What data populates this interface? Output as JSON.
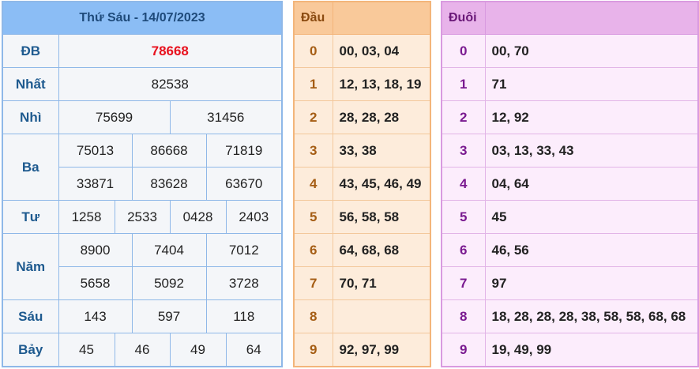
{
  "results": {
    "title": "Thứ Sáu - 14/07/2023",
    "db_label": "ĐB",
    "db": "78668",
    "nhat_label": "Nhất",
    "nhat": "82538",
    "nhi_label": "Nhì",
    "nhi": [
      "75699",
      "31456"
    ],
    "ba_label": "Ba",
    "ba": [
      "75013",
      "86668",
      "71819",
      "33871",
      "83628",
      "63670"
    ],
    "tu_label": "Tư",
    "tu": [
      "1258",
      "2533",
      "0428",
      "2403"
    ],
    "nam_label": "Năm",
    "nam": [
      "8900",
      "7404",
      "7012",
      "5658",
      "5092",
      "3728"
    ],
    "sau_label": "Sáu",
    "sau": [
      "143",
      "597",
      "118"
    ],
    "bay_label": "Bảy",
    "bay": [
      "45",
      "46",
      "49",
      "64"
    ]
  },
  "dau": {
    "title": "Đầu",
    "rows": [
      {
        "k": "0",
        "v": "00, 03, 04"
      },
      {
        "k": "1",
        "v": "12, 13, 18, 19"
      },
      {
        "k": "2",
        "v": "28, 28, 28"
      },
      {
        "k": "3",
        "v": "33, 38"
      },
      {
        "k": "4",
        "v": "43, 45, 46, 49"
      },
      {
        "k": "5",
        "v": "56, 58, 58"
      },
      {
        "k": "6",
        "v": "64, 68, 68"
      },
      {
        "k": "7",
        "v": "70, 71"
      },
      {
        "k": "8",
        "v": ""
      },
      {
        "k": "9",
        "v": "92, 97, 99"
      }
    ]
  },
  "duoi": {
    "title": "Đuôi",
    "rows": [
      {
        "k": "0",
        "v": "00, 70"
      },
      {
        "k": "1",
        "v": "71"
      },
      {
        "k": "2",
        "v": "12, 92"
      },
      {
        "k": "3",
        "v": "03, 13, 33, 43"
      },
      {
        "k": "4",
        "v": "04, 64"
      },
      {
        "k": "5",
        "v": "45"
      },
      {
        "k": "6",
        "v": "46, 56"
      },
      {
        "k": "7",
        "v": "97"
      },
      {
        "k": "8",
        "v": "18, 28, 28, 28, 38, 58, 58, 68, 68"
      },
      {
        "k": "9",
        "v": "19, 49, 99"
      }
    ]
  }
}
